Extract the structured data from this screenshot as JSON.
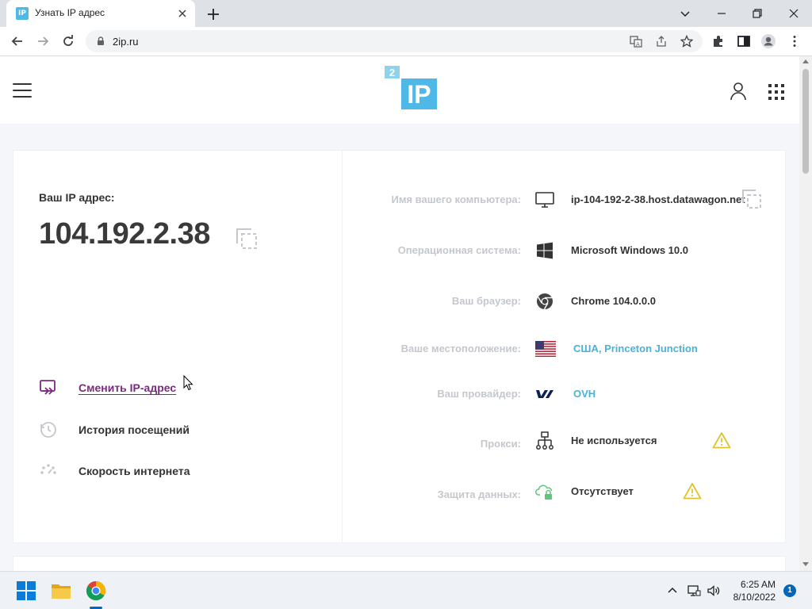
{
  "browser": {
    "tab_title": "Узнать IP адрес",
    "tab_favicon": "IP",
    "url": "2ip.ru"
  },
  "site": {
    "logo_badge": "2",
    "logo_text": "IP"
  },
  "left_panel": {
    "ip_label": "Ваш IP адрес:",
    "ip_value": "104.192.2.38",
    "actions": [
      {
        "label": "Сменить IP-адрес",
        "icon": "change-ip-icon"
      },
      {
        "label": "История посещений",
        "icon": "history-icon"
      },
      {
        "label": "Скорость интернета",
        "icon": "speed-icon"
      }
    ]
  },
  "info_rows": [
    {
      "label": "Имя вашего компьютера:",
      "value": "ip-104-192-2-38.host.datawagon.net",
      "icon": "monitor-icon"
    },
    {
      "label": "Операционная система:",
      "value": "Microsoft Windows 10.0",
      "icon": "windows-icon"
    },
    {
      "label": "Ваш браузер:",
      "value": "Chrome 104.0.0.0",
      "icon": "chrome-icon"
    },
    {
      "label": "Ваше местоположение:",
      "value": "США, Princeton Junction",
      "icon": "us-flag-icon"
    },
    {
      "label": "Ваш провайдер:",
      "value": "OVH",
      "icon": "ovh-icon"
    },
    {
      "label": "Прокси:",
      "value": "Не используется",
      "icon": "network-icon",
      "warning": true
    },
    {
      "label": "Защита данных:",
      "value": "Отсутствует",
      "icon": "cloud-lock-icon",
      "warning": true
    }
  ],
  "taskbar": {
    "time": "6:25 AM",
    "date": "8/10/2022",
    "notification_count": "1"
  },
  "colors": {
    "accent": "#4ab2d7",
    "link": "#7b2a7d",
    "warning": "#e0c22e",
    "label_gray": "#c4c8cd"
  }
}
